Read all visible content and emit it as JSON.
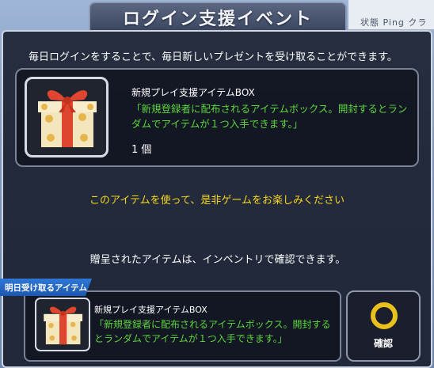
{
  "window": {
    "title": "ログイン支援イベント",
    "background_text": "状態  Ping  クラ"
  },
  "modal": {
    "intro": "毎日ログインをすることで、毎日新しいプレゼントを受け取ることができます。",
    "today_item": {
      "name": "新規プレイ支援アイテムBOX",
      "description": "「新規登録者に配布されるアイテムボックス。開封するとランダムでアイテムが１つ入手できます。」",
      "quantity": "1 個",
      "icon": "gift-box-icon"
    },
    "promo": "このアイテムを使って、是非ゲームをお楽しみください",
    "inventory_note": "贈呈されたアイテムは、インベントリで確認できます。",
    "tomorrow": {
      "badge": "明日受け取るアイテム",
      "name": "新規プレイ支援アイテムBOX",
      "description": "「新規登録者に配布されるアイテムボックス。開封するとランダムでアイテムが１つ入手できます。」",
      "icon": "gift-box-icon"
    },
    "confirm": {
      "label": "確認",
      "icon": "circle-confirm-icon"
    }
  },
  "colors": {
    "accent_green": "#5bd63c",
    "accent_yellow": "#f7d51e",
    "badge_blue": "#2f78d6",
    "ring_gold": "#e8c21a"
  }
}
